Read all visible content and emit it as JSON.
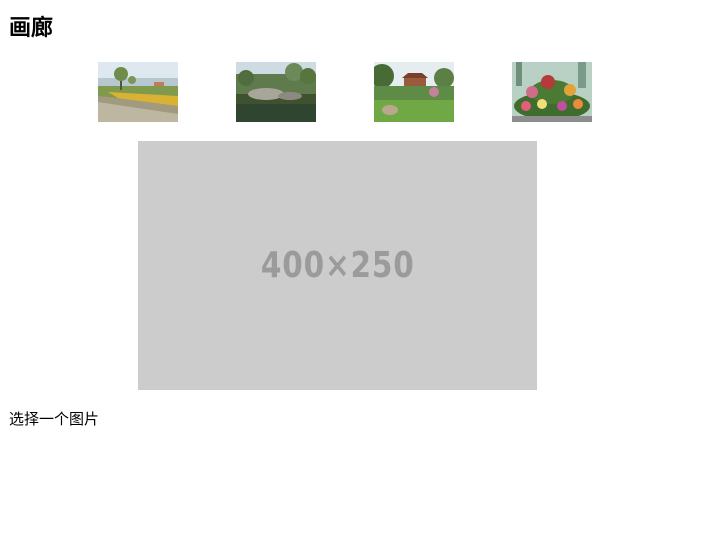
{
  "gallery": {
    "title": "画廊",
    "thumbnails": [
      {
        "name": "thumb-field-path"
      },
      {
        "name": "thumb-pond-rocks"
      },
      {
        "name": "thumb-lawn-pavilion"
      },
      {
        "name": "thumb-flower-display"
      }
    ],
    "placeholder_text": "400×250",
    "caption": "选择一个图片"
  }
}
